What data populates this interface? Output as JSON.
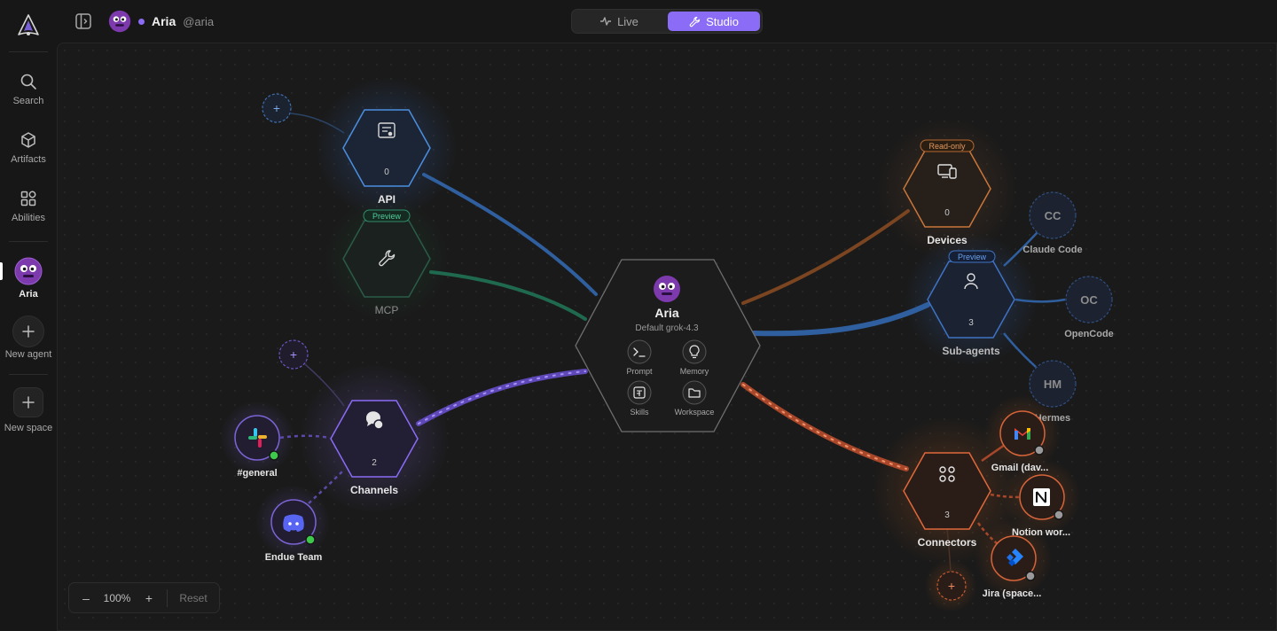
{
  "rail": {
    "items": [
      {
        "label": "Search"
      },
      {
        "label": "Artifacts"
      },
      {
        "label": "Abilities"
      },
      {
        "label": "Aria"
      },
      {
        "label": "New agent"
      },
      {
        "label": "New space"
      }
    ]
  },
  "header": {
    "agent_name": "Aria",
    "agent_handle": "@aria",
    "modes": [
      {
        "label": "Live"
      },
      {
        "label": "Studio"
      }
    ],
    "active_mode": "Studio"
  },
  "center": {
    "name": "Aria",
    "model": "Default grok-4.3",
    "actions": [
      {
        "label": "Prompt",
        "icon": "terminal-icon"
      },
      {
        "label": "Memory",
        "icon": "lightbulb-icon"
      },
      {
        "label": "Skills",
        "icon": "skills-icon"
      },
      {
        "label": "Workspace",
        "icon": "folder-icon"
      }
    ]
  },
  "nodes": {
    "api": {
      "label": "API",
      "count": "0",
      "color": "#4b8fe0"
    },
    "mcp": {
      "label": "MCP",
      "badge": "Preview",
      "color": "#2f8f6c"
    },
    "channels": {
      "label": "Channels",
      "count": "2",
      "color": "#8b6cf6"
    },
    "devices": {
      "label": "Devices",
      "count": "0",
      "badge": "Read-only",
      "color": "#c9763a"
    },
    "subagents": {
      "label": "Sub-agents",
      "count": "3",
      "badge": "Preview",
      "color": "#3f73c4"
    },
    "connectors": {
      "label": "Connectors",
      "count": "3",
      "color": "#e0683b"
    }
  },
  "channel_items": [
    {
      "label": "#general",
      "icon": "slack-icon"
    },
    {
      "label": "Endue Team",
      "icon": "discord-icon"
    }
  ],
  "subagent_items": [
    {
      "label": "Claude Code",
      "initials": "CC"
    },
    {
      "label": "OpenCode",
      "initials": "OC"
    },
    {
      "label": "Hermes",
      "initials": "HM"
    }
  ],
  "connector_items": [
    {
      "label": "Gmail (dav...",
      "icon": "gmail-icon"
    },
    {
      "label": "Notion wor...",
      "icon": "notion-icon"
    },
    {
      "label": "Jira (space...",
      "icon": "jira-icon"
    }
  ],
  "add_buttons": [
    {
      "label": "+"
    },
    {
      "label": "+"
    },
    {
      "label": "+"
    }
  ],
  "zoom": {
    "minus": "–",
    "level": "100%",
    "plus": "+",
    "reset": "Reset"
  }
}
